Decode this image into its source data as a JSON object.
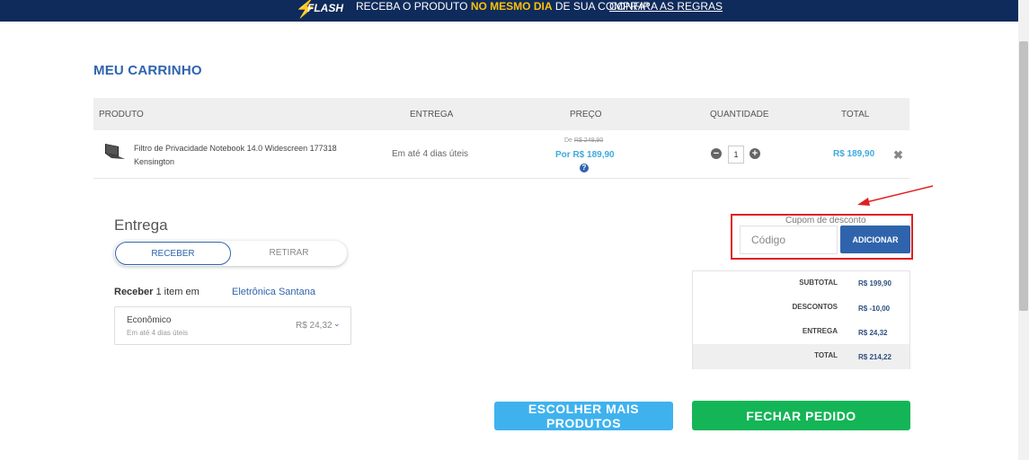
{
  "banner": {
    "logo_text": "FLASH",
    "message_prefix": "RECEBA O PRODUTO ",
    "message_highlight": "NO MESMO DIA",
    "message_suffix": " DE SUA COMPRA*",
    "rules_link": "CONFIRA AS REGRAS",
    "bg_color": "#0f2b5b",
    "highlight_color": "#ffc107"
  },
  "page_title": "MEU CARRINHO",
  "table": {
    "headers": [
      "PRODUTO",
      "ENTREGA",
      "PREÇO",
      "QUANTIDADE",
      "TOTAL"
    ],
    "rows": [
      {
        "product_name": "Filtro de Privacidade Notebook 14.0 Widescreen 177318 Kensington",
        "product_icon": "laptop-icon",
        "delivery": "Em até 4 dias úteis",
        "price_old_prefix": "De ",
        "price_old": "R$ 249,90",
        "price_new": "Por R$ 189,90",
        "quantity": "1",
        "total": "R$ 189,90"
      }
    ]
  },
  "delivery": {
    "title": "Entrega",
    "options": [
      "RECEBER",
      "RETIRAR"
    ],
    "selected_option": "RECEBER",
    "receive_label": "Receber",
    "receive_count": " 1 item em",
    "store": "Eletrônica Santana",
    "shipping": {
      "name": "Econômico",
      "eta": "Em até 4 dias úteis",
      "price": "R$ 24,32"
    }
  },
  "coupon": {
    "label": "Cupom de desconto",
    "placeholder": "Código",
    "button": "ADICIONAR"
  },
  "summary": {
    "subtotal_label": "SUBTOTAL",
    "subtotal": "R$ 199,90",
    "discounts_label": "DESCONTOS",
    "discounts": "R$ -10,00",
    "shipping_label": "ENTREGA",
    "shipping": "R$ 24,32",
    "total_label": "TOTAL",
    "total": "R$ 214,22"
  },
  "actions": {
    "more_products": "ESCOLHER MAIS PRODUTOS",
    "checkout": "FECHAR PEDIDO"
  },
  "colors": {
    "primary": "#2f64ad",
    "accent": "#3fa9dc",
    "checkout": "#14b556",
    "annotation": "#e02020"
  }
}
